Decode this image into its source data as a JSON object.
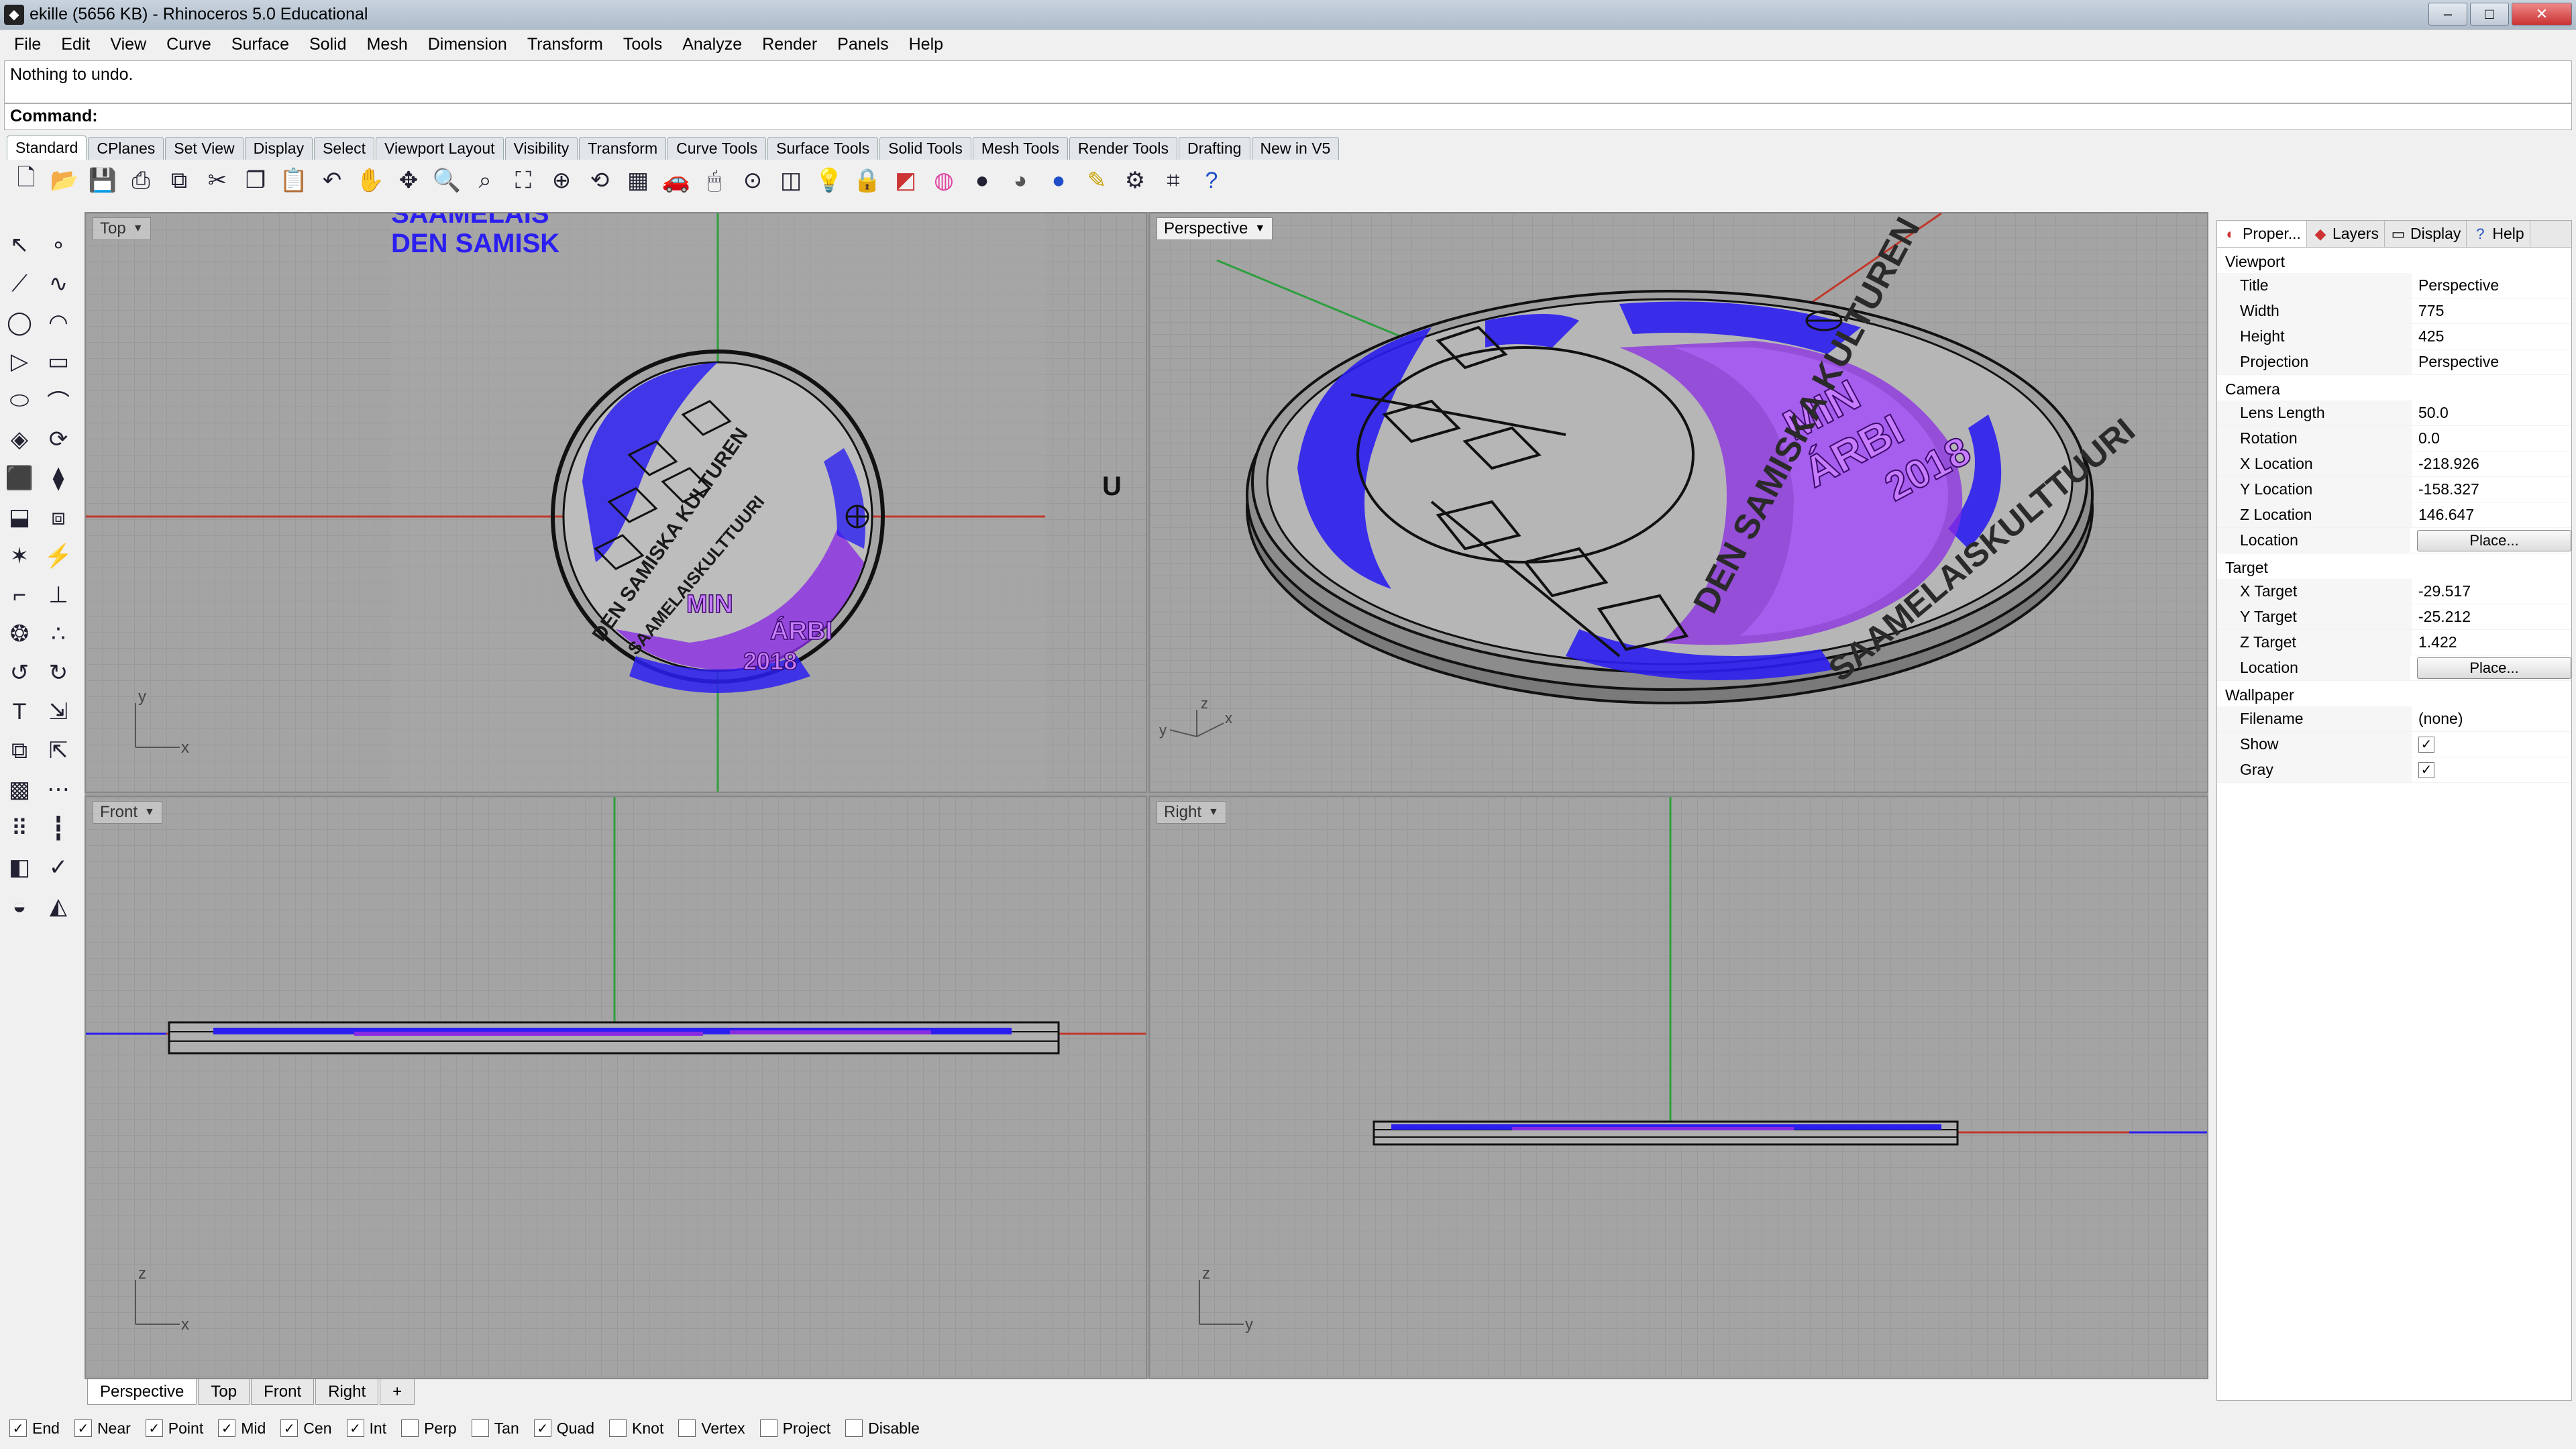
{
  "window": {
    "title": "ekille (5656 KB) - Rhinoceros 5.0 Educational"
  },
  "menu": [
    "File",
    "Edit",
    "View",
    "Curve",
    "Surface",
    "Solid",
    "Mesh",
    "Dimension",
    "Transform",
    "Tools",
    "Analyze",
    "Render",
    "Panels",
    "Help"
  ],
  "command": {
    "history": "Nothing to undo.",
    "prompt": "Command:"
  },
  "toolbar_tabs": [
    "Standard",
    "CPlanes",
    "Set View",
    "Display",
    "Select",
    "Viewport Layout",
    "Visibility",
    "Transform",
    "Curve Tools",
    "Surface Tools",
    "Solid Tools",
    "Mesh Tools",
    "Render Tools",
    "Drafting",
    "New in V5"
  ],
  "toolbar_icons": [
    "new-file-icon",
    "open-file-icon",
    "save-icon",
    "print-icon",
    "import-icon",
    "cut-icon",
    "copy-icon",
    "paste-icon",
    "undo-icon",
    "pan-icon",
    "move-icon",
    "zoom-dynamic-icon",
    "zoom-window-icon",
    "zoom-extents-icon",
    "zoom-selected-icon",
    "rotate-view-icon",
    "grid-icon",
    "car-icon",
    "mouse-icon",
    "point-icon",
    "layer-icon",
    "light-icon",
    "lock-icon",
    "material-icon",
    "color-wheel-icon",
    "sphere-shaded-icon",
    "sphere-rendered-icon",
    "sphere-blue-icon",
    "highlighter-icon",
    "gear-icon",
    "options-icon",
    "help-icon"
  ],
  "left_tools": [
    "select-icon",
    "point-icon",
    "polyline-icon",
    "curve-icon",
    "circle-icon",
    "arc-icon",
    "polygon-icon",
    "rectangle-icon",
    "ellipse-icon",
    "freeform-icon",
    "surface-icon",
    "revolve-icon",
    "box-icon",
    "boolean-icon",
    "extrude-icon",
    "pipe-icon",
    "explode-icon",
    "split-icon",
    "fillet-icon",
    "trim-icon",
    "blob-icon",
    "join-icon",
    "rebuild-icon",
    "offset-icon",
    "text-icon",
    "dimension-icon",
    "array-icon",
    "transform-icon",
    "mesh-icon",
    "lattice-icon",
    "grid-array-icon",
    "pipe-tool-icon",
    "analyze-icon",
    "check-icon",
    "render-icon",
    "paint-icon"
  ],
  "viewports": {
    "top": {
      "label": "Top",
      "text_line1": "SAAMELAIS",
      "text_line2": "DEN SAMISK",
      "u_mark": "U"
    },
    "perspective": {
      "label": "Perspective"
    },
    "front": {
      "label": "Front"
    },
    "right": {
      "label": "Right"
    }
  },
  "coin": {
    "ring_outer": "DEN SAMISKA KULTUREN",
    "ring_inner": "SAAMELAISKULTTUURI",
    "word1": "MIN",
    "word2": "ÁRBI",
    "year": "2018"
  },
  "axes": {
    "x": "x",
    "y": "y",
    "z": "z"
  },
  "viewport_tabs": [
    "Perspective",
    "Top",
    "Front",
    "Right"
  ],
  "add_tab": "+",
  "panel": {
    "tabs": [
      {
        "label": "Proper...",
        "icon": "properties-icon"
      },
      {
        "label": "Layers",
        "icon": "layers-icon"
      },
      {
        "label": "Display",
        "icon": "display-icon"
      },
      {
        "label": "Help",
        "icon": "help-icon"
      }
    ],
    "viewport_section": "Viewport",
    "title_label": "Title",
    "title_value": "Perspective",
    "width_label": "Width",
    "width_value": "775",
    "height_label": "Height",
    "height_value": "425",
    "projection_label": "Projection",
    "projection_value": "Perspective",
    "camera_section": "Camera",
    "lens_label": "Lens Length",
    "lens_value": "50.0",
    "rotation_label": "Rotation",
    "rotation_value": "0.0",
    "xloc_label": "X Location",
    "xloc_value": "-218.926",
    "yloc_label": "Y Location",
    "yloc_value": "-158.327",
    "zloc_label": "Z Location",
    "zloc_value": "146.647",
    "location_label": "Location",
    "place_button": "Place...",
    "target_section": "Target",
    "xt_label": "X Target",
    "xt_value": "-29.517",
    "yt_label": "Y Target",
    "yt_value": "-25.212",
    "zt_label": "Z Target",
    "zt_value": "1.422",
    "wallpaper_section": "Wallpaper",
    "filename_label": "Filename",
    "filename_value": "(none)",
    "show_label": "Show",
    "gray_label": "Gray"
  },
  "osnaps": [
    {
      "label": "End",
      "checked": true
    },
    {
      "label": "Near",
      "checked": true
    },
    {
      "label": "Point",
      "checked": true
    },
    {
      "label": "Mid",
      "checked": true
    },
    {
      "label": "Cen",
      "checked": true
    },
    {
      "label": "Int",
      "checked": true
    },
    {
      "label": "Perp",
      "checked": false
    },
    {
      "label": "Tan",
      "checked": false
    },
    {
      "label": "Quad",
      "checked": true
    },
    {
      "label": "Knot",
      "checked": false
    },
    {
      "label": "Vertex",
      "checked": false
    },
    {
      "label": "Project",
      "checked": false
    },
    {
      "label": "Disable",
      "checked": false
    }
  ],
  "colors": {
    "coin_blue": "#2b1ef0",
    "coin_purple": "#8a2be2",
    "axis_red": "#c0392b",
    "axis_green": "#2e9e3e"
  }
}
